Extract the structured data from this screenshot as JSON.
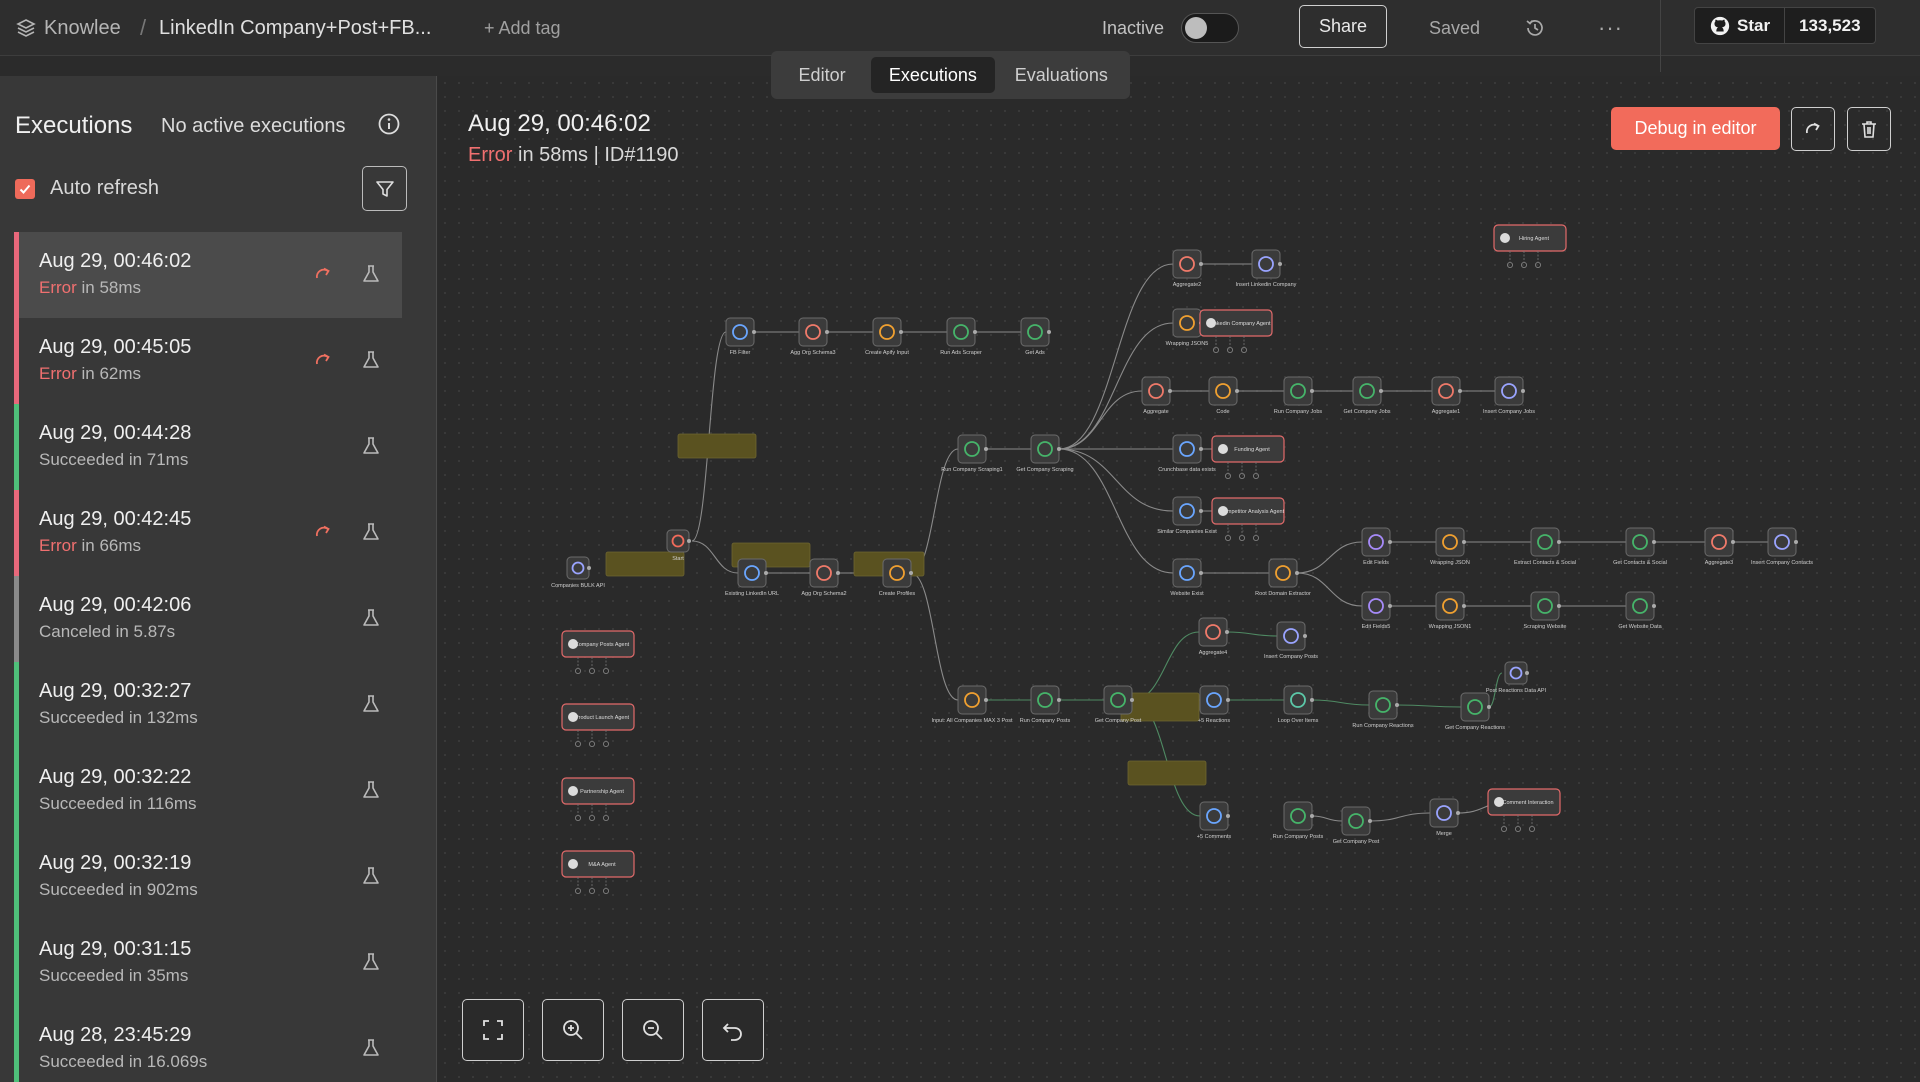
{
  "topbar": {
    "workspace": "Knowlee",
    "separator": "/",
    "workflow_name": "LinkedIn Company+Post+FB...",
    "add_tag": "+ Add tag",
    "inactive_label": "Inactive",
    "share_label": "Share",
    "saved_label": "Saved",
    "more_label": "···",
    "github_star": "Star",
    "github_count": "133,523"
  },
  "tabs": [
    "Editor",
    "Executions",
    "Evaluations"
  ],
  "sidebar": {
    "title": "Executions",
    "no_active": "No active executions",
    "auto_refresh": "Auto refresh",
    "executions": [
      {
        "date": "Aug 29, 00:46:02",
        "status": "Error",
        "duration": "in 58ms"
      },
      {
        "date": "Aug 29, 00:45:05",
        "status": "Error",
        "duration": "in 62ms"
      },
      {
        "date": "Aug 29, 00:44:28",
        "status": "Succeeded",
        "duration": "in 71ms"
      },
      {
        "date": "Aug 29, 00:42:45",
        "status": "Error",
        "duration": "in 66ms"
      },
      {
        "date": "Aug 29, 00:42:06",
        "status": "Canceled",
        "duration": "in 5.87s"
      },
      {
        "date": "Aug 29, 00:32:27",
        "status": "Succeeded",
        "duration": "in 132ms"
      },
      {
        "date": "Aug 29, 00:32:22",
        "status": "Succeeded",
        "duration": "in 116ms"
      },
      {
        "date": "Aug 29, 00:32:19",
        "status": "Succeeded",
        "duration": "in 902ms"
      },
      {
        "date": "Aug 29, 00:31:15",
        "status": "Succeeded",
        "duration": "in 35ms"
      },
      {
        "date": "Aug 28, 23:45:29",
        "status": "Succeeded",
        "duration": "in 16.069s"
      }
    ]
  },
  "detail": {
    "date": "Aug 29, 00:46:02",
    "status": "Error",
    "meta": "in 58ms | ID#1190",
    "debug_label": "Debug in editor"
  },
  "colors": {
    "error": "#f07070",
    "success": "#4fbf7a",
    "accent": "#f26b5b",
    "canceled": "#8a8a8a"
  },
  "workflow": {
    "nodes": [
      {
        "label": "Start",
        "icon": "trigger"
      },
      {
        "label": "Companies BULK API",
        "icon": "globe"
      },
      {
        "label": "Existing LinkedIn URL",
        "icon": "filter"
      },
      {
        "label": "Agg Org Schema2",
        "icon": "aggregate"
      },
      {
        "label": "Create Profiles",
        "icon": "code"
      },
      {
        "label": "FB Filter",
        "icon": "filter"
      },
      {
        "label": "Agg Org Schema3",
        "icon": "aggregate"
      },
      {
        "label": "Create Apify Input",
        "icon": "code"
      },
      {
        "label": "Run Ads Scraper",
        "icon": "apify"
      },
      {
        "label": "Get Ads",
        "icon": "apify"
      },
      {
        "label": "Run Company Scraping1",
        "icon": "apify"
      },
      {
        "label": "Get Company Scraping",
        "icon": "apify"
      },
      {
        "label": "Aggregate2",
        "icon": "aggregate"
      },
      {
        "label": "Insert Linkedin Company",
        "icon": "globe"
      },
      {
        "label": "Wrapping JSON5",
        "icon": "code"
      },
      {
        "label": "Linkedin Company Agent",
        "icon": "agent"
      },
      {
        "label": "Aggregate",
        "icon": "aggregate"
      },
      {
        "label": "Code",
        "icon": "code"
      },
      {
        "label": "Run Company Jobs",
        "icon": "apify"
      },
      {
        "label": "Get Company Jobs",
        "icon": "apify"
      },
      {
        "label": "Aggregate1",
        "icon": "aggregate"
      },
      {
        "label": "Insert Company Jobs",
        "icon": "globe"
      },
      {
        "label": "Hiring Agent",
        "icon": "agent"
      },
      {
        "label": "Crunchbase data exists",
        "icon": "filter"
      },
      {
        "label": "Funding Agent",
        "icon": "agent"
      },
      {
        "label": "Similar Companies Exist",
        "icon": "filter"
      },
      {
        "label": "Competitor Analysis Agent",
        "icon": "agent"
      },
      {
        "label": "Website Exist",
        "icon": "filter"
      },
      {
        "label": "Root Domain Extractor",
        "icon": "code"
      },
      {
        "label": "Edit Fields",
        "icon": "edit"
      },
      {
        "label": "Wrapping JSON",
        "icon": "code"
      },
      {
        "label": "Extract Contacts & Social",
        "icon": "apify"
      },
      {
        "label": "Get Contacts & Social",
        "icon": "apify"
      },
      {
        "label": "Aggregate3",
        "icon": "aggregate"
      },
      {
        "label": "Insert Company Contacts",
        "icon": "globe"
      },
      {
        "label": "Edit Fields5",
        "icon": "edit"
      },
      {
        "label": "Wrapping JSON1",
        "icon": "code"
      },
      {
        "label": "Scraping Website",
        "icon": "apify"
      },
      {
        "label": "Get Website Data",
        "icon": "apify"
      },
      {
        "label": "Company Posts Agent",
        "icon": "agent"
      },
      {
        "label": "Product Launch Agent",
        "icon": "agent"
      },
      {
        "label": "Partnership Agent",
        "icon": "agent"
      },
      {
        "label": "M&A Agent",
        "icon": "agent"
      },
      {
        "label": "Input: All Companies MAX 3 Post",
        "icon": "code"
      },
      {
        "label": "Run Company Posts",
        "icon": "apify"
      },
      {
        "label": "Get Company Post",
        "icon": "apify"
      },
      {
        "label": "Aggregate4",
        "icon": "aggregate"
      },
      {
        "label": "Insert Company Posts",
        "icon": "globe"
      },
      {
        "label": "+5 Reactions",
        "icon": "filter"
      },
      {
        "label": "Loop Over Items",
        "icon": "loop"
      },
      {
        "label": "Run Company Reactions",
        "icon": "apify"
      },
      {
        "label": "Get Company Reactions",
        "icon": "apify"
      },
      {
        "label": "Post Reactions Data API",
        "icon": "globe"
      },
      {
        "label": "+5 Comments",
        "icon": "filter"
      },
      {
        "label": "Run Company Posts",
        "icon": "apify"
      },
      {
        "label": "Get Company Post",
        "icon": "apify"
      },
      {
        "label": "Merge",
        "icon": "merge"
      },
      {
        "label": "Comment Interaction",
        "icon": "agent"
      }
    ]
  }
}
